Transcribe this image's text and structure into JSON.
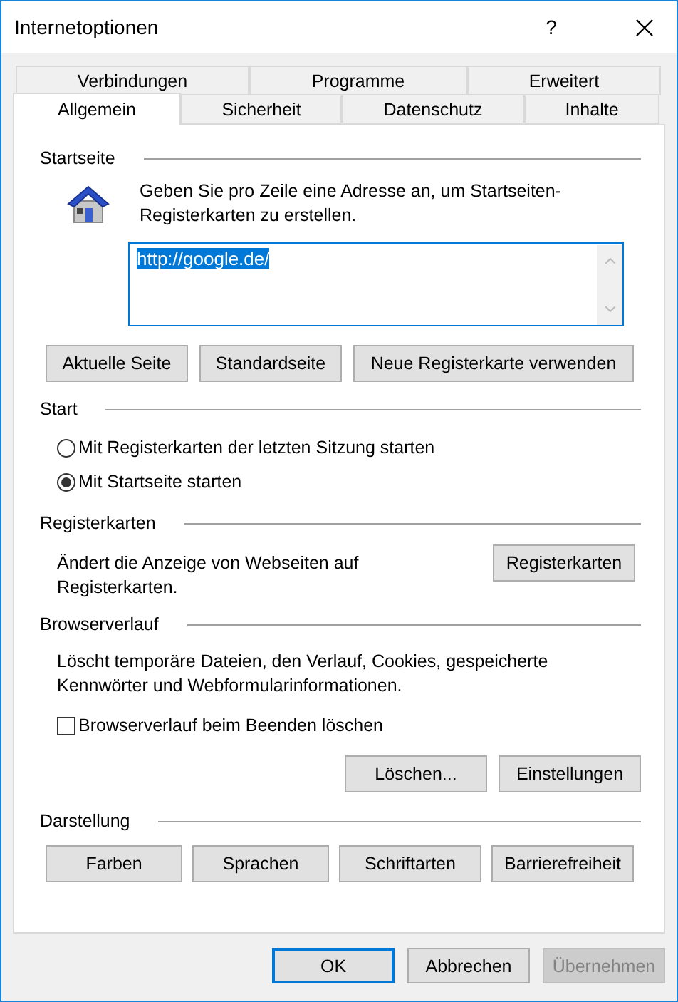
{
  "window": {
    "title": "Internetoptionen",
    "help": "?"
  },
  "tab_rows": [
    [
      {
        "label": "Verbindungen",
        "selected": false
      },
      {
        "label": "Programme",
        "selected": false
      },
      {
        "label": "Erweitert",
        "selected": false
      }
    ],
    [
      {
        "label": "Allgemein",
        "selected": true
      },
      {
        "label": "Sicherheit",
        "selected": false
      },
      {
        "label": "Datenschutz",
        "selected": false
      },
      {
        "label": "Inhalte",
        "selected": false
      }
    ]
  ],
  "home_page": {
    "title": "Startseite",
    "description": "Geben Sie pro Zeile eine Adresse an, um Startseiten-Registerkarten zu erstellen.",
    "value": "http://google.de/",
    "value_selected": true,
    "buttons": [
      "Aktuelle Seite",
      "Standardseite",
      "Neue Registerkarte verwenden"
    ]
  },
  "start": {
    "title": "Start",
    "options": [
      {
        "label": "Mit Registerkarten der letzten Sitzung starten",
        "selected": false
      },
      {
        "label": "Mit Startseite starten",
        "selected": true
      }
    ]
  },
  "tabs_group": {
    "title": "Registerkarten",
    "description": "Ändert die Anzeige von Webseiten auf Registerkarten.",
    "button": "Registerkarten"
  },
  "history": {
    "title": "Browserverlauf",
    "description": "Löscht temporäre Dateien, den Verlauf, Cookies, gespeicherte Kennwörter und Webformularinformationen.",
    "checkbox": {
      "label": "Browserverlauf beim Beenden löschen",
      "checked": false
    },
    "buttons": [
      "Löschen...",
      "Einstellungen"
    ]
  },
  "appearance": {
    "title": "Darstellung",
    "buttons": [
      "Farben",
      "Sprachen",
      "Schriftarten",
      "Barrierefreiheit"
    ]
  },
  "footer_buttons": [
    {
      "label": "OK",
      "default": true,
      "disabled": false
    },
    {
      "label": "Abbrechen",
      "default": false,
      "disabled": false
    },
    {
      "label": "Übernehmen",
      "default": false,
      "disabled": true
    }
  ]
}
